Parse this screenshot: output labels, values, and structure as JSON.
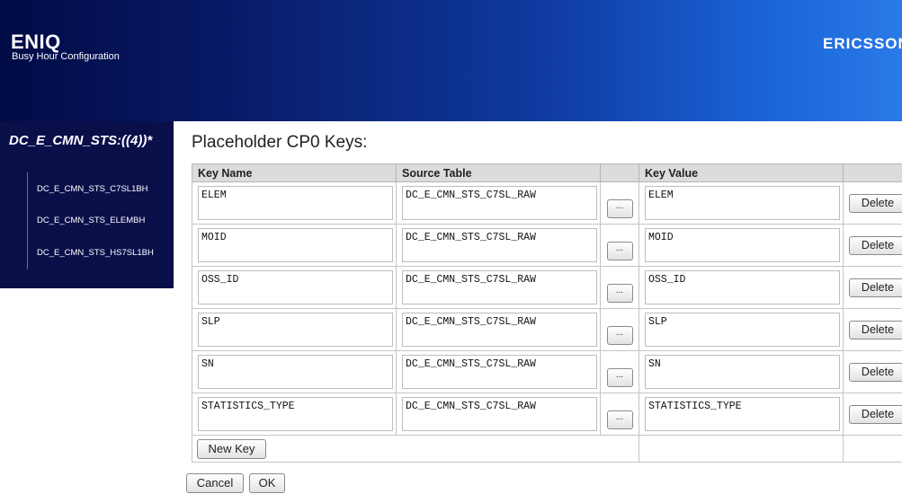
{
  "header": {
    "app_title": "ENIQ",
    "app_subtitle": "Busy Hour Configuration",
    "brand": "ERICSSON"
  },
  "sidebar": {
    "title": "DC_E_CMN_STS:((4))*",
    "items": [
      {
        "label": "DC_E_CMN_STS_C7SL1BH"
      },
      {
        "label": "DC_E_CMN_STS_ELEMBH"
      },
      {
        "label": "DC_E_CMN_STS_HS7SL1BH"
      }
    ]
  },
  "main": {
    "heading": "Placeholder CP0 Keys:",
    "columns": {
      "key_name": "Key Name",
      "source_table": "Source Table",
      "key_value": "Key Value"
    },
    "rows": [
      {
        "key_name": "ELEM",
        "source_table": "DC_E_CMN_STS_C7SL_RAW",
        "key_value": "ELEM",
        "browse_label": "...",
        "delete_label": "Delete"
      },
      {
        "key_name": "MOID",
        "source_table": "DC_E_CMN_STS_C7SL_RAW",
        "key_value": "MOID",
        "browse_label": "...",
        "delete_label": "Delete"
      },
      {
        "key_name": "OSS_ID",
        "source_table": "DC_E_CMN_STS_C7SL_RAW",
        "key_value": "OSS_ID",
        "browse_label": "...",
        "delete_label": "Delete"
      },
      {
        "key_name": "SLP",
        "source_table": "DC_E_CMN_STS_C7SL_RAW",
        "key_value": "SLP",
        "browse_label": "...",
        "delete_label": "Delete"
      },
      {
        "key_name": "SN",
        "source_table": "DC_E_CMN_STS_C7SL_RAW",
        "key_value": "SN",
        "browse_label": "...",
        "delete_label": "Delete"
      },
      {
        "key_name": "STATISTICS_TYPE",
        "source_table": "DC_E_CMN_STS_C7SL_RAW",
        "key_value": "STATISTICS_TYPE",
        "browse_label": "...",
        "delete_label": "Delete"
      }
    ],
    "new_key_label": "New Key",
    "cancel_label": "Cancel",
    "ok_label": "OK"
  }
}
